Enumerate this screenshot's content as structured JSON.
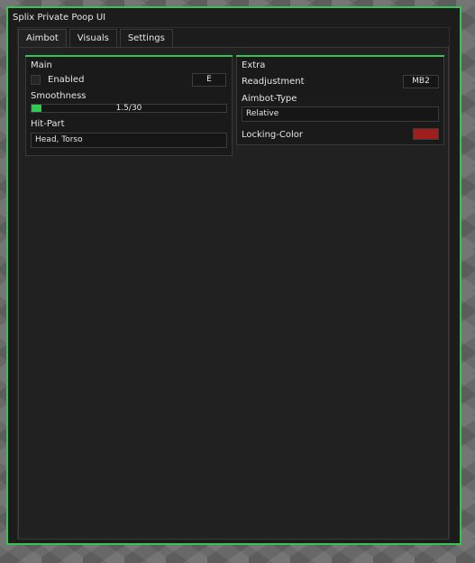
{
  "window": {
    "title": "Splix Private Poop UI",
    "accent_color": "#35c552"
  },
  "tabs": [
    {
      "label": "Aimbot",
      "active": true
    },
    {
      "label": "Visuals",
      "active": false
    },
    {
      "label": "Settings",
      "active": false
    }
  ],
  "main": {
    "title": "Main",
    "enabled_label": "Enabled",
    "enabled_checked": false,
    "enabled_key": "E",
    "smoothness_label": "Smoothness",
    "smoothness_value": "1.5/30",
    "smoothness_fraction": 0.05,
    "hitpart_label": "Hit-Part",
    "hitpart_value": "Head, Torso"
  },
  "extra": {
    "title": "Extra",
    "readjustment_label": "Readjustment",
    "readjustment_key": "MB2",
    "aimbot_type_label": "Aimbot-Type",
    "aimbot_type_value": "Relative",
    "locking_color_label": "Locking-Color",
    "locking_color": "#a01e1e"
  }
}
